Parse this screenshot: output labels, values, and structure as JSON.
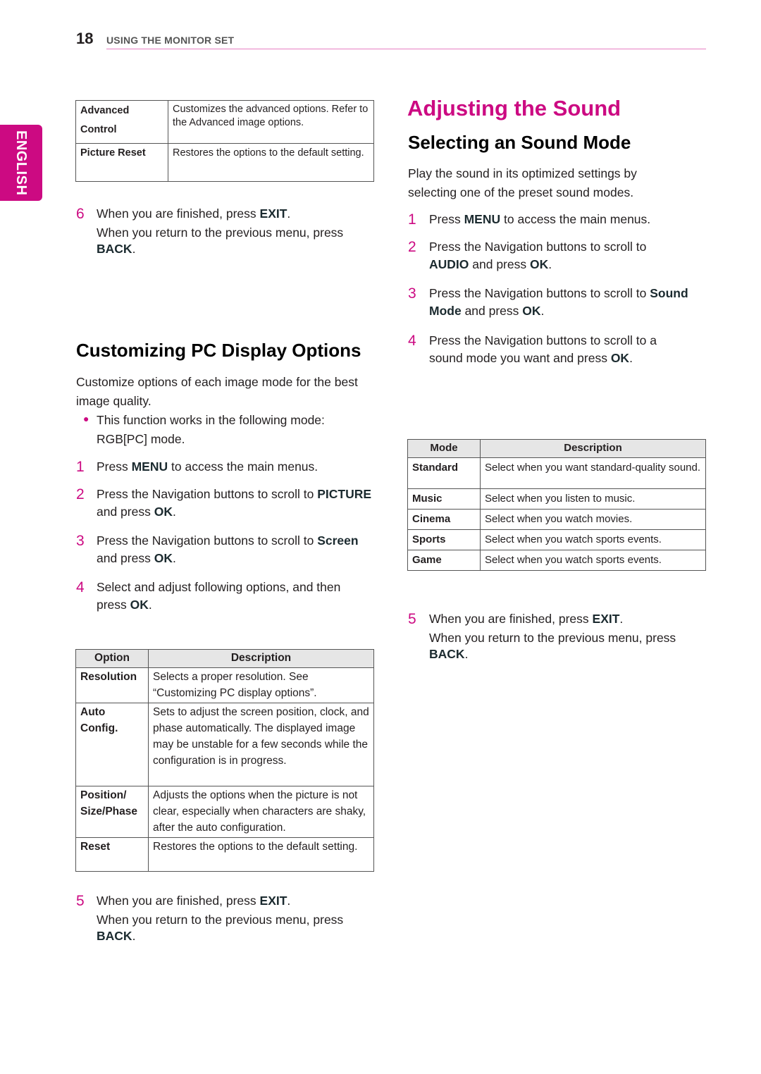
{
  "header": {
    "page_number": "18",
    "section": "USING THE MONITOR SET"
  },
  "side_tab": {
    "label": "ENGLISH"
  },
  "colors": {
    "accent": "#cc0a82",
    "rule": "#e67fc3",
    "table_header_bg": "#e6e6e6"
  },
  "left": {
    "top_table": {
      "rows": [
        {
          "key_line1": "Advanced",
          "key_line2": "Control",
          "desc": "Customizes the advanced options. Refer to the Advanced image options."
        },
        {
          "key_line1": "Picture Reset",
          "key_line2": "",
          "desc": "Restores the options to the default setting."
        }
      ]
    },
    "step6": {
      "number": "6",
      "pre": "When you are finished, press ",
      "key": "EXIT",
      "post": ".",
      "note_pre": "When you return to the previous menu, press ",
      "note_key": "BACK",
      "note_post": "."
    },
    "section_title": "Customizing PC Display Options",
    "intro": "Customize options of each image mode for the best image quality.",
    "bullet": "This function works in the following mode: RGB[PC] mode.",
    "steps": [
      {
        "number": "1",
        "a": "Press ",
        "b": "MENU",
        "c": " to access the main menus.",
        "d": "",
        "e": ""
      },
      {
        "number": "2",
        "a": "Press the Navigation buttons to scroll to ",
        "b": "PICTURE",
        "c": " and press ",
        "d": "OK",
        "e": "."
      },
      {
        "number": "3",
        "a": "Press the Navigation buttons to scroll to ",
        "b": "Screen",
        "c": " and press ",
        "d": "OK",
        "e": "."
      },
      {
        "number": "4",
        "a": "Select and adjust following options, and then press ",
        "b": "OK",
        "c": ".",
        "d": "",
        "e": ""
      }
    ],
    "options_table": {
      "headers": [
        "Option",
        "Description"
      ],
      "rows": [
        {
          "key": "Resolution",
          "desc": "Selects a proper resolution. See “Customizing PC display options”."
        },
        {
          "key": "Auto Config.",
          "desc": "Sets to adjust the screen position, clock, and phase automatically. The displayed image may be unstable for a few seconds while the configuration is in progress."
        },
        {
          "key": "Position/ Size/Phase",
          "desc": "Adjusts the options when the picture is not clear, especially when characters are shaky, after the auto configuration."
        },
        {
          "key": "Reset",
          "desc": "Restores the options to the default setting."
        }
      ]
    },
    "step5": {
      "number": "5",
      "pre": "When you are finished, press ",
      "key": "EXIT",
      "post": ".",
      "note_pre": "When you return to the previous menu, press ",
      "note_key": "BACK",
      "note_post": "."
    }
  },
  "right": {
    "title": "Adjusting the Sound",
    "subtitle": "Selecting an Sound Mode",
    "intro": "Play the sound in its optimized settings by selecting one of the preset sound modes.",
    "steps": [
      {
        "number": "1",
        "a": "Press ",
        "b": "MENU",
        "c": " to access the main menus.",
        "d": "",
        "e": ""
      },
      {
        "number": "2",
        "a": "Press the Navigation buttons to scroll to ",
        "b": "AUDIO",
        "c": " and press ",
        "d": "OK",
        "e": "."
      },
      {
        "number": "3",
        "a": "Press the Navigation buttons to scroll to ",
        "b": "Sound Mode",
        "c": " and press ",
        "d": "OK",
        "e": "."
      },
      {
        "number": "4",
        "a": "Press the Navigation buttons to scroll to a sound mode you want and press ",
        "b": "OK",
        "c": ".",
        "d": "",
        "e": ""
      }
    ],
    "mode_table": {
      "headers": [
        "Mode",
        "Description"
      ],
      "rows": [
        {
          "key": "Standard",
          "desc": "Select when you want standard-quality sound."
        },
        {
          "key": "Music",
          "desc": "Select when you listen to music."
        },
        {
          "key": "Cinema",
          "desc": "Select when you watch movies."
        },
        {
          "key": "Sports",
          "desc": "Select when you watch sports events."
        },
        {
          "key": "Game",
          "desc": "Select when you watch sports events."
        }
      ]
    },
    "step5": {
      "number": "5",
      "pre": "When you are finished, press ",
      "key": "EXIT",
      "post": ".",
      "note_pre": "When you return to the previous menu, press ",
      "note_key": "BACK",
      "note_post": "."
    }
  }
}
